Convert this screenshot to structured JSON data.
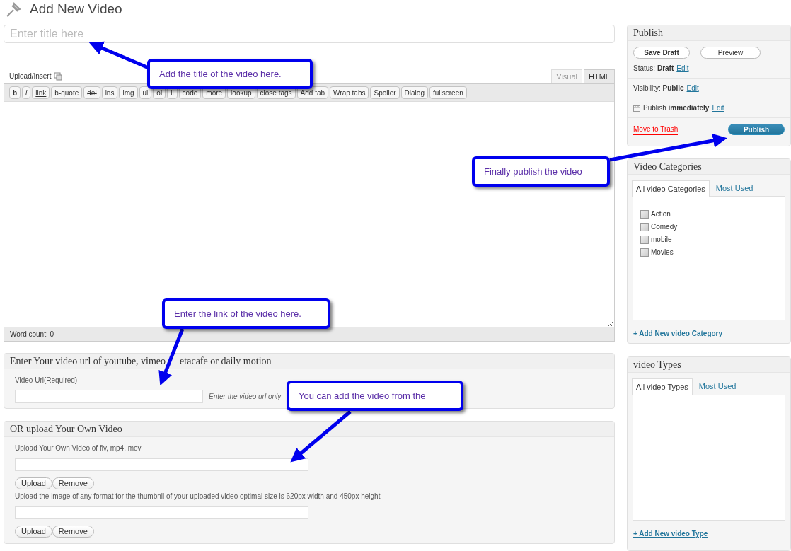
{
  "page_title": "Add New Video",
  "title_field": {
    "placeholder": "Enter title here"
  },
  "upload_insert": "Upload/Insert",
  "editor_tabs": [
    {
      "label": "Visual",
      "selected": false
    },
    {
      "label": "HTML",
      "selected": true
    }
  ],
  "toolbar": [
    {
      "label": "b",
      "kind": "bold"
    },
    {
      "label": "i",
      "kind": "italic"
    },
    {
      "label": "link",
      "kind": "underline"
    },
    {
      "label": "b-quote",
      "kind": "plain"
    },
    {
      "label": "del",
      "kind": "strike"
    },
    {
      "label": "ins",
      "kind": "plain"
    },
    {
      "label": "img",
      "kind": "plain"
    },
    {
      "label": "ul",
      "kind": "plain"
    },
    {
      "label": "ol",
      "kind": "plain"
    },
    {
      "label": "li",
      "kind": "plain"
    },
    {
      "label": "code",
      "kind": "plain"
    },
    {
      "label": "more",
      "kind": "plain"
    },
    {
      "label": "lookup",
      "kind": "plain"
    },
    {
      "label": "close tags",
      "kind": "plain"
    },
    {
      "label": "Add tab",
      "kind": "plain"
    },
    {
      "label": "Wrap tabs",
      "kind": "plain"
    },
    {
      "label": "Spoiler",
      "kind": "plain"
    },
    {
      "label": "Dialog",
      "kind": "plain"
    },
    {
      "label": "fullscreen",
      "kind": "plain"
    }
  ],
  "word_count": "Word count: 0",
  "url_box": {
    "title_parts": [
      "Enter Your video url of youtube, vimeo",
      "etacafe or daily motion"
    ],
    "label": "Video Url(Required)",
    "hint": "Enter the video url only"
  },
  "upload_box": {
    "title": "OR upload Your Own Video",
    "video_label": "Upload Your Own Video of flv, mp4, mov",
    "thumb_label": "Upload the image of any format for the thumbnil of your uploaded video optimal size is 620px width and 450px height",
    "buttons": [
      "Upload",
      "Remove"
    ],
    "thumb_buttons": [
      "Upload",
      "Remove"
    ]
  },
  "publish": {
    "title": "Publish",
    "save_draft": "Save Draft",
    "preview": "Preview",
    "rows": [
      {
        "kind": "plain",
        "label": "Status:",
        "value": "Draft",
        "link": "Edit"
      },
      {
        "kind": "plain",
        "label": "Visibility:",
        "value": "Public",
        "link": "Edit"
      },
      {
        "kind": "calendar",
        "label": "Publish",
        "value": "immediately",
        "link": "Edit"
      }
    ],
    "trash": "Move to Trash",
    "publish_button": "Publish"
  },
  "categories": {
    "title": "Video Categories",
    "tabs": [
      {
        "label": "All video Categories",
        "selected": true
      },
      {
        "label": "Most Used",
        "selected": false
      }
    ],
    "items": [
      {
        "label": "Action",
        "checked": false
      },
      {
        "label": "Comedy",
        "checked": false
      },
      {
        "label": "mobile",
        "checked": false
      },
      {
        "label": "Movies",
        "checked": false
      }
    ],
    "add_link": "+ Add New video Category"
  },
  "types": {
    "title": "video Types",
    "tabs": [
      {
        "label": "All video Types",
        "selected": true
      },
      {
        "label": "Most Used",
        "selected": false
      }
    ],
    "add_link": "+ Add New video Type"
  },
  "callouts": [
    {
      "text": "Add the title of the video here."
    },
    {
      "text": "Finally publish the video"
    },
    {
      "text": "Enter the link of the video here."
    },
    {
      "text": "You can add the video from the"
    }
  ]
}
